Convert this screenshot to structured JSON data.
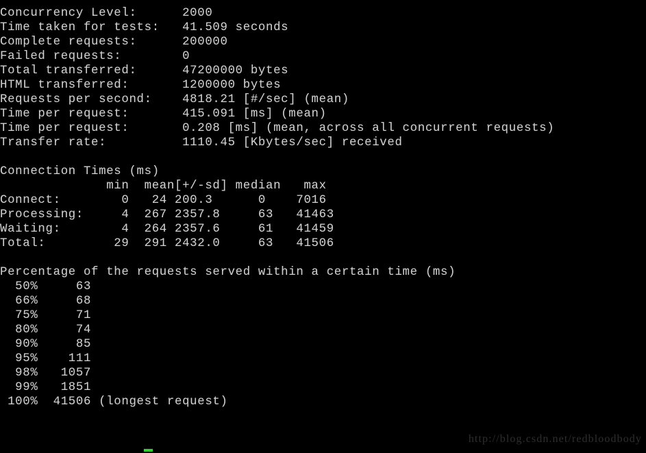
{
  "terminal": {
    "background_color": "#000000",
    "foreground_color": "#cfcfcf",
    "cursor_color": "#33cc33",
    "program": "ab"
  },
  "summary": {
    "rows": [
      {
        "label": "Concurrency Level:",
        "value": "2000"
      },
      {
        "label": "Time taken for tests:",
        "value": "41.509 seconds"
      },
      {
        "label": "Complete requests:",
        "value": "200000"
      },
      {
        "label": "Failed requests:",
        "value": "0"
      },
      {
        "label": "Total transferred:",
        "value": "47200000 bytes"
      },
      {
        "label": "HTML transferred:",
        "value": "1200000 bytes"
      },
      {
        "label": "Requests per second:",
        "value": "4818.21 [#/sec] (mean)"
      },
      {
        "label": "Time per request:",
        "value": "415.091 [ms] (mean)"
      },
      {
        "label": "Time per request:",
        "value": "0.208 [ms] (mean, across all concurrent requests)"
      },
      {
        "label": "Transfer rate:",
        "value": "1110.45 [Kbytes/sec] received"
      }
    ]
  },
  "connection_times": {
    "title": "Connection Times (ms)",
    "columns": [
      "min",
      "mean[+/-sd]",
      "median",
      "max"
    ],
    "rows": [
      {
        "label": "Connect:",
        "min": "0",
        "mean": "24",
        "sd": "200.3",
        "median": "0",
        "max": "7016"
      },
      {
        "label": "Processing:",
        "min": "4",
        "mean": "267",
        "sd": "2357.8",
        "median": "63",
        "max": "41463"
      },
      {
        "label": "Waiting:",
        "min": "4",
        "mean": "264",
        "sd": "2357.6",
        "median": "61",
        "max": "41459"
      },
      {
        "label": "Total:",
        "min": "29",
        "mean": "291",
        "sd": "2432.0",
        "median": "63",
        "max": "41506"
      }
    ]
  },
  "percentiles": {
    "title": "Percentage of the requests served within a certain time (ms)",
    "rows": [
      {
        "percent": "50%",
        "value": "63",
        "note": ""
      },
      {
        "percent": "66%",
        "value": "68",
        "note": ""
      },
      {
        "percent": "75%",
        "value": "71",
        "note": ""
      },
      {
        "percent": "80%",
        "value": "74",
        "note": ""
      },
      {
        "percent": "90%",
        "value": "85",
        "note": ""
      },
      {
        "percent": "95%",
        "value": "111",
        "note": ""
      },
      {
        "percent": "98%",
        "value": "1057",
        "note": ""
      },
      {
        "percent": "99%",
        "value": "1851",
        "note": ""
      },
      {
        "percent": "100%",
        "value": "41506",
        "note": "(longest request)"
      }
    ]
  },
  "watermark": {
    "text": "http://blog.csdn.net/redbloodbody"
  },
  "console_text": "Concurrency Level:      2000\nTime taken for tests:   41.509 seconds\nComplete requests:      200000\nFailed requests:        0\nTotal transferred:      47200000 bytes\nHTML transferred:       1200000 bytes\nRequests per second:    4818.21 [#/sec] (mean)\nTime per request:       415.091 [ms] (mean)\nTime per request:       0.208 [ms] (mean, across all concurrent requests)\nTransfer rate:          1110.45 [Kbytes/sec] received\n\nConnection Times (ms)\n              min  mean[+/-sd] median   max\nConnect:        0   24 200.3      0    7016\nProcessing:     4  267 2357.8     63   41463\nWaiting:        4  264 2357.6     61   41459\nTotal:         29  291 2432.0     63   41506\n\nPercentage of the requests served within a certain time (ms)\n  50%     63\n  66%     68\n  75%     71\n  80%     74\n  90%     85\n  95%    111\n  98%   1057\n  99%   1851\n 100%  41506 (longest request)"
}
